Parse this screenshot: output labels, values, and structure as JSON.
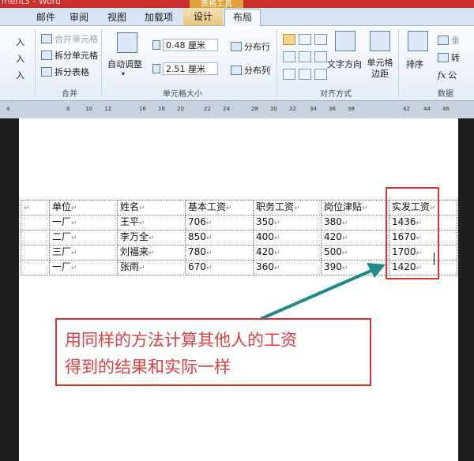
{
  "window": {
    "title_fragment": "ment3 - Word",
    "context_title": "表格工具"
  },
  "tabs": [
    "邮件",
    "审阅",
    "视图",
    "加载项",
    "设计",
    "布局"
  ],
  "ribbon": {
    "merge": {
      "merge_cells": "合并单元格",
      "split_cells": "拆分单元格",
      "split_table": "拆分表格",
      "label": "合并",
      "left_items": [
        "入",
        "入",
        "入"
      ]
    },
    "cell_size": {
      "autofit": "自动调整",
      "height_value": "0.48 厘米",
      "width_value": "2.51 厘米",
      "distribute_rows": "分布行",
      "distribute_cols": "分布列",
      "label": "单元格大小"
    },
    "alignment": {
      "text_direction": "文字方向",
      "cell_margins": "单元格边距",
      "label": "对齐方式"
    },
    "data": {
      "sort": "排序",
      "convert": "转",
      "formula": "公",
      "repeat": "重",
      "label": "数据"
    }
  },
  "ruler": {
    "ticks": [
      "4",
      "8",
      "10",
      "12",
      "16",
      "18",
      "20",
      "22",
      "24",
      "28",
      "30",
      "32",
      "34",
      "36",
      "38",
      "42",
      "44",
      "46"
    ]
  },
  "doc_table": {
    "headers": [
      "单位",
      "姓名",
      "基本工资",
      "职务工资",
      "岗位津贴",
      "实发工资"
    ],
    "rows": [
      [
        "一厂",
        "王平",
        "706",
        "350",
        "380",
        "1436"
      ],
      [
        "二厂",
        "李万全",
        "850",
        "400",
        "420",
        "1670"
      ],
      [
        "三厂",
        "刘福来",
        "780",
        "420",
        "500",
        "1700"
      ],
      [
        "一厂",
        "张雨",
        "670",
        "360",
        "390",
        "1420"
      ]
    ]
  },
  "callout": {
    "line1": "用同样的方法计算其他人的工资",
    "line2": "得到的结果和实际一样"
  },
  "colors": {
    "highlight": "#d8332e",
    "arrow": "#1f8a8a"
  }
}
